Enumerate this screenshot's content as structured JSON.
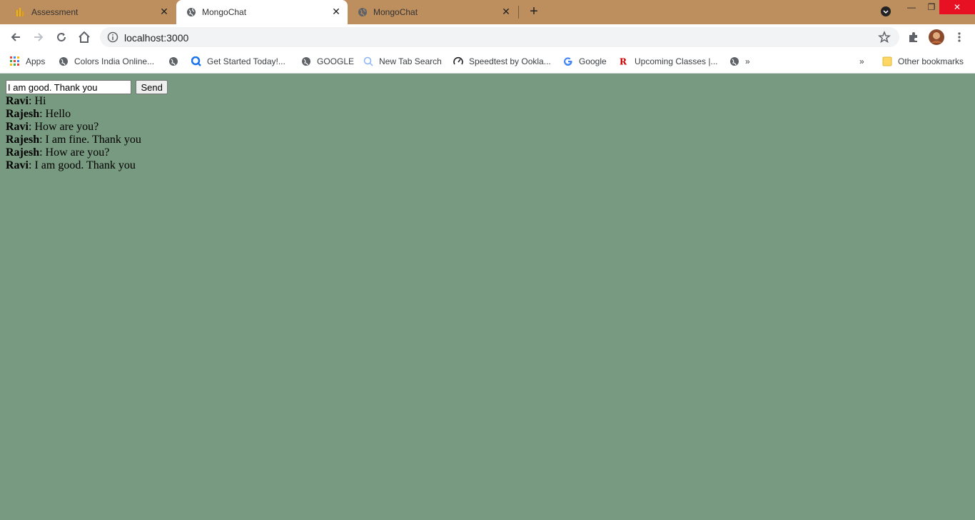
{
  "browser": {
    "tabs": [
      {
        "title": "Assessment",
        "active": false
      },
      {
        "title": "MongoChat",
        "active": true
      },
      {
        "title": "MongoChat",
        "active": false
      }
    ],
    "address": "localhost:3000",
    "bookmarks": [
      {
        "label": "Apps",
        "icon": "apps-grid-icon"
      },
      {
        "label": "Colors India Online...",
        "icon": "globe-icon"
      },
      {
        "label": "Get Started Today!...",
        "icon": "search-q-icon"
      },
      {
        "label": "GOOGLE",
        "icon": "globe-icon"
      },
      {
        "label": "New Tab Search",
        "icon": "search-icon"
      },
      {
        "label": "Speedtest by Ookla...",
        "icon": "speedometer-icon"
      },
      {
        "label": "Google",
        "icon": "google-g-icon"
      },
      {
        "label": "Upcoming Classes |...",
        "icon": "r-logo-icon"
      },
      {
        "label": "»",
        "icon": "globe-icon"
      }
    ],
    "bookmarks_overflow": "»",
    "other_bookmarks": "Other bookmarks"
  },
  "chat": {
    "input_value": "I am good. Thank you",
    "send_label": "Send",
    "messages": [
      {
        "name": "Ravi",
        "text": ": Hi"
      },
      {
        "name": "Rajesh",
        "text": ": Hello"
      },
      {
        "name": "Ravi",
        "text": ": How are you?"
      },
      {
        "name": "Rajesh",
        "text": ": I am fine. Thank you"
      },
      {
        "name": "Rajesh",
        "text": ": How are you?"
      },
      {
        "name": "Ravi",
        "text": ": I am good. Thank you"
      }
    ]
  },
  "colors": {
    "page_background": "#789a80",
    "titlebar": "#bd8e5e"
  }
}
